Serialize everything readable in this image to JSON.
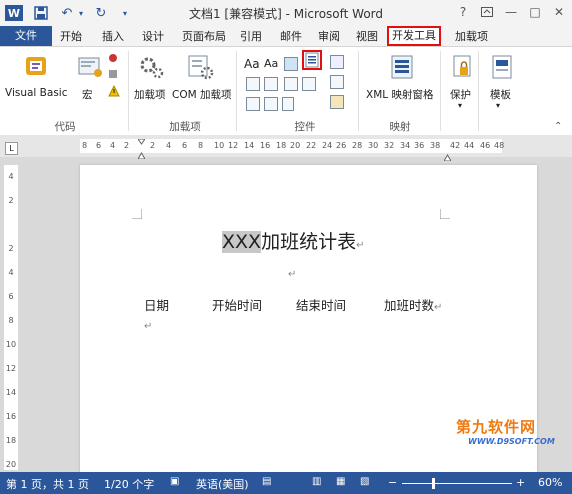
{
  "window": {
    "title": "文档1 [兼容模式] - Microsoft Word",
    "help": "?",
    "min": "—",
    "max": "□",
    "close": "✕"
  },
  "qat": {
    "undo": "↶",
    "redo": "↻",
    "save": "💾"
  },
  "tabs": [
    {
      "label": "文件"
    },
    {
      "label": "开始"
    },
    {
      "label": "插入"
    },
    {
      "label": "设计"
    },
    {
      "label": "页面布局"
    },
    {
      "label": "引用"
    },
    {
      "label": "邮件"
    },
    {
      "label": "审阅"
    },
    {
      "label": "视图"
    },
    {
      "label": "开发工具"
    },
    {
      "label": "加载项"
    }
  ],
  "ribbon": {
    "code": {
      "group": "代码",
      "vb": "Visual Basic",
      "macro": "宏"
    },
    "addins": {
      "group": "加载项",
      "addin": "加载项",
      "com": "COM 加载项"
    },
    "controls": {
      "group": "控件",
      "aa1": "Aa",
      "aa2": "Aa"
    },
    "mapping": {
      "group": "映射",
      "xml": "XML 映射窗格"
    },
    "protect": {
      "label": "保护"
    },
    "template": {
      "label": "模板"
    }
  },
  "ruler": {
    "h": [
      "8",
      "6",
      "4",
      "2",
      "2",
      "4",
      "6",
      "8",
      "10",
      "12",
      "14",
      "16",
      "18",
      "20",
      "22",
      "24",
      "26",
      "28",
      "30",
      "32",
      "34",
      "36",
      "38",
      "42",
      "44",
      "46",
      "48"
    ],
    "v": [
      "4",
      "2",
      "2",
      "4",
      "6",
      "8",
      "10",
      "12",
      "14",
      "16",
      "18",
      "20"
    ],
    "corner": "L"
  },
  "document": {
    "highlight": "XXX",
    "title": "加班统计表",
    "headers": [
      "日期",
      "开始时间",
      "结束时间",
      "加班时数"
    ],
    "para": "↵"
  },
  "status": {
    "page": "第 1 页，共 1 页",
    "words": "1/20 个字",
    "lang": "英语(美国)",
    "zoom": "60%",
    "zoom_level": 0.6
  },
  "watermark": {
    "brand": "第九软件网",
    "url": "WWW.D9SOFT.COM"
  },
  "colors": {
    "accent": "#2b579a",
    "highlight_box": "#e01010",
    "watermark": "#f07a12"
  }
}
